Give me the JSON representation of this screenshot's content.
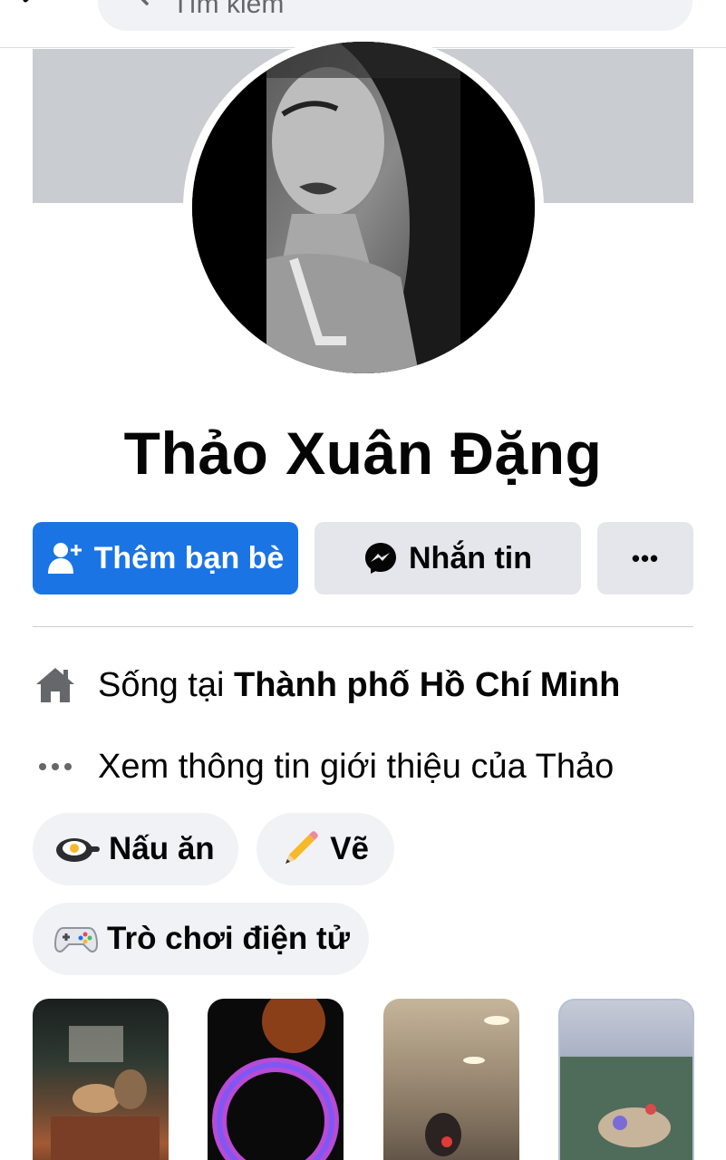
{
  "header": {
    "search_placeholder": "Tìm kiếm"
  },
  "profile": {
    "name": "Thảo Xuân Đặng"
  },
  "actions": {
    "add_friend_label": "Thêm bạn bè",
    "message_label": "Nhắn tin",
    "more_label": "•••"
  },
  "intro": {
    "lives_in_prefix": "Sống tại ",
    "lives_in_city": "Thành phố Hồ Chí Minh",
    "see_about": "Xem thông tin giới thiệu của Thảo"
  },
  "hobbies": [
    {
      "label": "Nấu ăn",
      "icon": "frying-pan-egg-icon"
    },
    {
      "label": "Vẽ",
      "icon": "pencil-icon"
    },
    {
      "label": "Trò chơi điện tử",
      "icon": "game-controller-icon"
    }
  ],
  "colors": {
    "accent": "#1b74e4",
    "secondary_button": "#e4e6eb",
    "chip_background": "#f0f2f5",
    "cover": "#c9ccd1"
  }
}
